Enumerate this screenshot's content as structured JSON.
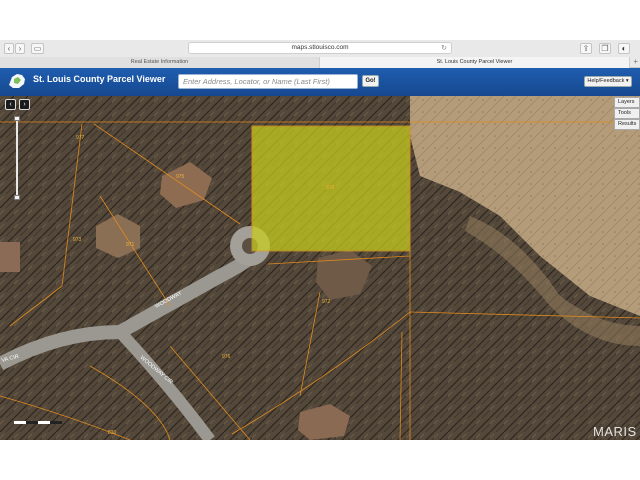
{
  "browser": {
    "url": "maps.stlouisco.com",
    "tabs": [
      {
        "label": "Real Estate Information"
      },
      {
        "label": "St. Louis County Parcel Viewer"
      }
    ],
    "new_tab": "+"
  },
  "app": {
    "title": "St. Louis County Parcel Viewer",
    "search": {
      "placeholder": "Enter Address, Locator, or Name (Last First)",
      "value": ""
    },
    "go_label": "Go!",
    "help_label": "Help/Feedback ▾"
  },
  "map": {
    "nav": {
      "back": "‹",
      "forward": "›"
    },
    "panels": {
      "layers": "Layers",
      "tools": "Tools",
      "results": "Results"
    },
    "parcel_labels": [
      "977",
      "975",
      "973",
      "970",
      "971",
      "972",
      "974",
      "976",
      "830"
    ],
    "street_labels": [
      "WOODWAY",
      "WOODWAY CIR",
      "VA CIR"
    ],
    "highlight_color": "#c9cf1c",
    "parcel_line_color": "#e08a1e"
  },
  "watermark": "MARIS"
}
